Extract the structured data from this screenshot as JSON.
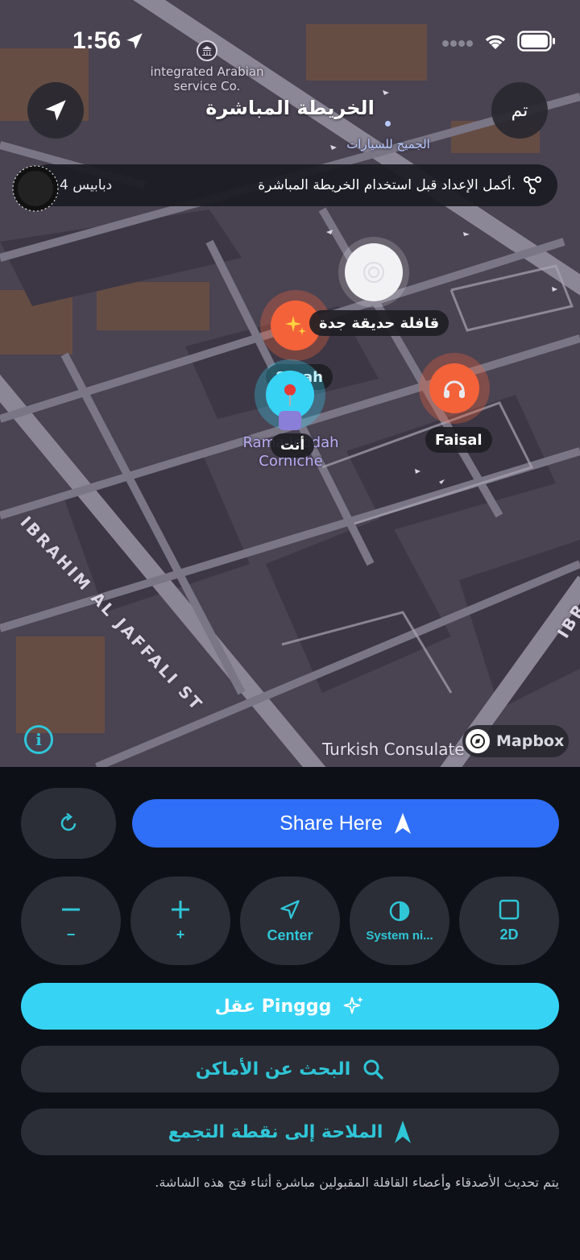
{
  "status_bar": {
    "time": "1:56"
  },
  "map": {
    "poi_company": "integrated Arabian\nservice Co.",
    "poi_cars": "الجميح للسيارات",
    "poi_place": "Rama Jeddah\nCorniche",
    "street_ibrahim": "IBRAHIM AL JAFFALI ST",
    "street_edge": "IBR",
    "consulate": "Turkish Consulate",
    "attribution": "Mapbox"
  },
  "header": {
    "title": "الخريطة المباشرة",
    "done_label": "تم"
  },
  "setup_banner": {
    "message": "أكمل الإعداد قبل استخدام الخريطة المباشرة.",
    "pins": "4 دبابيس"
  },
  "markers": {
    "caravan_label": "قافلة حديقة جدة",
    "sarah_label": "Sarah",
    "me_label": "أنت",
    "faisal_label": "Faisal"
  },
  "panel": {
    "share_label": "Share Here",
    "controls": [
      {
        "icon": "minus-icon",
        "label": "−"
      },
      {
        "icon": "plus-icon",
        "label": "+"
      },
      {
        "icon": "location-arrow-icon",
        "label": "Center"
      },
      {
        "icon": "theme-icon",
        "label": "System ni..."
      },
      {
        "icon": "square-icon",
        "label": "2D"
      }
    ],
    "ping_label": "عقل Pinggg",
    "search_label": "البحث عن الأماكن",
    "navigate_label": "الملاحة إلى نقطة التجمع",
    "footer_note": "يتم تحديث الأصدقاء وأعضاء القافلة المقبولين مباشرة أثناء فتح هذه الشاشة."
  },
  "colors": {
    "accent_cyan": "#36d3f5",
    "share_blue": "#2f6ef6",
    "marker_orange": "#f4623a",
    "map_ground": "#4a4352"
  }
}
